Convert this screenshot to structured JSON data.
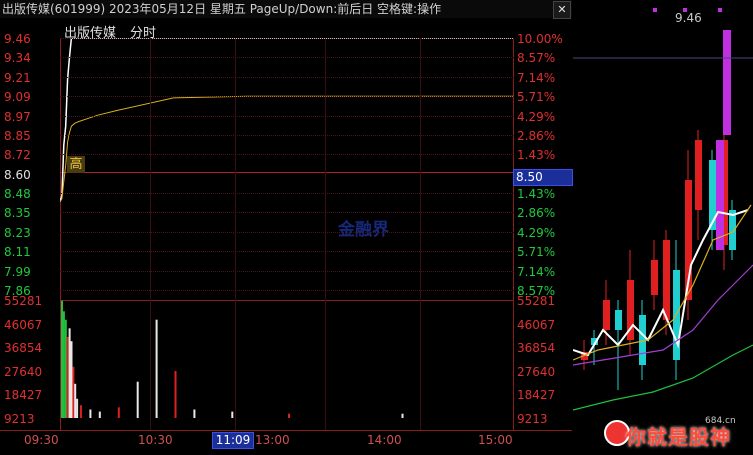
{
  "window": {
    "title": "出版传媒(601999)  2023年05月12日  星期五  PageUp/Down:前后日  空格键:操作",
    "close_label": "✕"
  },
  "chart_tabs": {
    "name": "出版传媒",
    "mode": "分时"
  },
  "price_axis_left": [
    "9.46",
    "9.34",
    "9.21",
    "9.09",
    "8.97",
    "8.85",
    "8.72",
    "8.60",
    "8.48",
    "8.35",
    "8.23",
    "8.11",
    "7.99",
    "7.86"
  ],
  "pct_axis_right": [
    "10.00%",
    "8.57%",
    "7.14%",
    "5.71%",
    "4.29%",
    "2.86%",
    "1.43%",
    "",
    "1.43%",
    "2.86%",
    "4.29%",
    "5.71%",
    "7.14%",
    "8.57%"
  ],
  "volume_axis": [
    "55281",
    "46067",
    "36854",
    "27640",
    "18427",
    "9213"
  ],
  "time_axis": [
    "09:30",
    "10:30",
    "11:09",
    "13:00",
    "14:00",
    "15:00"
  ],
  "cursor": {
    "price": "8.50",
    "time": "11:09"
  },
  "high_marker": "高",
  "watermark": "金融界",
  "kline_panel": {
    "last_price": "9.46"
  },
  "brand_badge": {
    "text": "你就是股神",
    "site": "684.cn"
  },
  "colors": {
    "up": "#e02020",
    "down": "#20d0d0",
    "price_line": "#ffffff",
    "avg_line": "#d8b020",
    "accent": "#1b2f9a",
    "ma5": "#ffffff",
    "ma10": "#d8b020",
    "ma20": "#a040d0",
    "ma60": "#20c040"
  },
  "chart_data": [
    {
      "type": "line",
      "title": "分时",
      "xlabel": "",
      "ylabel": "",
      "ylim": [
        7.86,
        9.46
      ],
      "x": [
        "09:30",
        "09:31",
        "09:32",
        "09:33",
        "09:34",
        "09:35",
        "09:36",
        "09:38",
        "09:40",
        "09:45",
        "09:50",
        "10:00",
        "10:30",
        "11:09",
        "13:00",
        "14:00",
        "15:00"
      ],
      "series": [
        {
          "values": [
            8.42,
            8.46,
            8.78,
            8.9,
            9.2,
            9.34,
            9.46,
            9.46,
            9.46,
            9.46,
            9.46,
            9.46,
            9.46,
            9.46,
            9.46,
            9.46,
            9.46
          ]
        },
        {
          "values": [
            8.42,
            8.44,
            8.55,
            8.65,
            8.8,
            8.86,
            8.9,
            8.92,
            8.93,
            8.95,
            8.97,
            9.0,
            9.08,
            9.09,
            9.09,
            9.09,
            9.09
          ]
        }
      ]
    },
    {
      "type": "bar",
      "title": "成交量",
      "ylim": [
        0,
        55281
      ],
      "x": [
        "09:30",
        "09:31",
        "09:32",
        "09:33",
        "09:34",
        "09:35",
        "09:36",
        "09:37",
        "09:38",
        "09:40",
        "09:45",
        "09:50",
        "10:00",
        "10:10",
        "10:20",
        "10:30",
        "10:40",
        "11:00",
        "13:00",
        "14:00",
        "15:00"
      ],
      "values": [
        55000,
        50000,
        46000,
        38000,
        42000,
        36000,
        24000,
        16000,
        9000,
        6000,
        4000,
        3000,
        5000,
        17000,
        46067,
        22000,
        4000,
        3000,
        2000,
        2000,
        1000
      ]
    }
  ]
}
